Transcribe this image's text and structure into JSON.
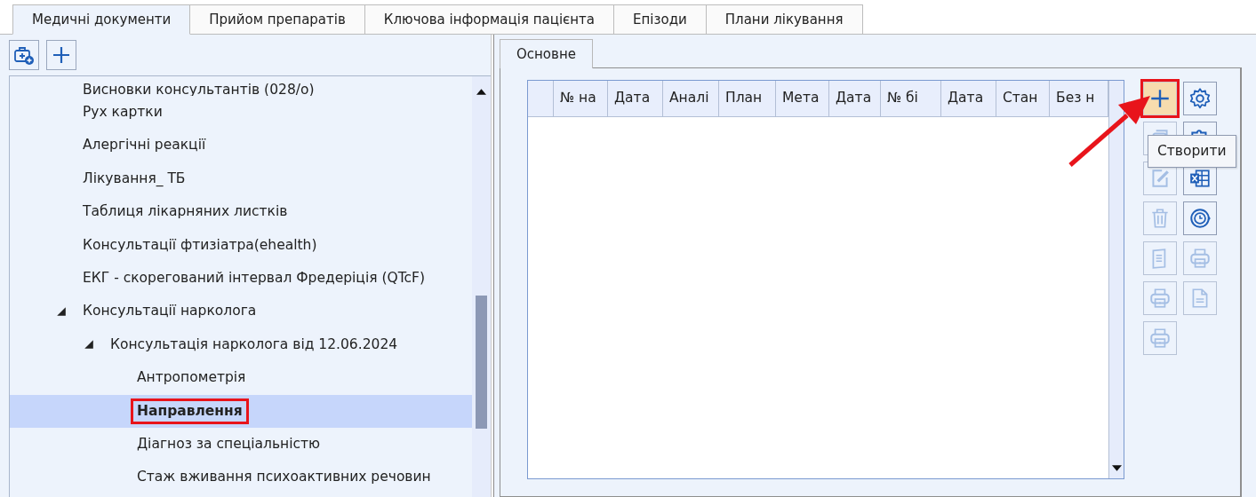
{
  "tabs": [
    {
      "label": "Медичні документи",
      "selected": true
    },
    {
      "label": "Прийом препаратів",
      "selected": false
    },
    {
      "label": "Ключова інформація пацієнта",
      "selected": false
    },
    {
      "label": "Епізоди",
      "selected": false
    },
    {
      "label": "Плани лікування",
      "selected": false
    }
  ],
  "left_toolbar": [
    {
      "kind": "add-kit"
    },
    {
      "kind": "plus"
    }
  ],
  "tree": {
    "items": [
      {
        "label": "Висновки консультантів (028/о)",
        "selected": false,
        "annotated": false
      },
      {
        "label": "Рух картки",
        "selected": false,
        "annotated": false
      },
      {
        "label": "Алергічні реакції",
        "selected": false,
        "annotated": false
      },
      {
        "label": "Лікування_ ТБ",
        "selected": false,
        "annotated": false
      },
      {
        "label": "Таблиця лікарняних листків",
        "selected": false,
        "annotated": false
      },
      {
        "label": "Консультації фтизіатра(ehealth)",
        "selected": false,
        "annotated": false
      },
      {
        "label": "ЕКГ - скорегований інтервал Фредеріція (QTcF)",
        "selected": false,
        "annotated": false
      },
      {
        "label": "Консультації нарколога",
        "selected": false,
        "annotated": false,
        "expanded": true,
        "children": [
          {
            "label": "Консультація нарколога від 12.06.2024",
            "selected": false,
            "annotated": false,
            "expanded": true,
            "children": [
              {
                "label": "Антропометрія",
                "selected": false,
                "annotated": false
              },
              {
                "label": "Направлення",
                "selected": true,
                "annotated": true
              },
              {
                "label": "Діагноз за спеціальністю",
                "selected": false,
                "annotated": false
              },
              {
                "label": "Стаж вживання психоактивних речовин",
                "selected": false,
                "annotated": false
              }
            ]
          }
        ]
      }
    ]
  },
  "inner_tabs": [
    {
      "label": "Основне",
      "selected": true
    }
  ],
  "table": {
    "columns": [
      "№ на",
      "Дата",
      "Аналі",
      "План",
      "Мета",
      "Дата",
      "№ бі",
      "Дата",
      "Стан",
      "Без н"
    ]
  },
  "tools": [
    {
      "kind": "plus",
      "enabled": true,
      "hovered": true,
      "annotated": true
    },
    {
      "kind": "gear",
      "enabled": true,
      "hovered": false,
      "annotated": false
    },
    {
      "kind": "copy",
      "enabled": false,
      "hovered": false,
      "annotated": false
    },
    {
      "kind": "puzzle",
      "enabled": true,
      "hovered": false,
      "annotated": false
    },
    {
      "kind": "edit",
      "enabled": false,
      "hovered": false,
      "annotated": false
    },
    {
      "kind": "excel",
      "enabled": true,
      "hovered": false,
      "annotated": false
    },
    {
      "kind": "trash",
      "enabled": false,
      "hovered": false,
      "annotated": false
    },
    {
      "kind": "clock",
      "enabled": true,
      "hovered": false,
      "annotated": false
    },
    {
      "kind": "document",
      "enabled": false,
      "hovered": false,
      "annotated": false
    },
    {
      "kind": "printer",
      "enabled": false,
      "hovered": false,
      "annotated": false
    },
    {
      "kind": "printer",
      "enabled": false,
      "hovered": false,
      "annotated": false
    },
    {
      "kind": "file",
      "enabled": false,
      "hovered": false,
      "annotated": false
    },
    {
      "kind": "printer",
      "enabled": false,
      "hovered": false,
      "annotated": false
    }
  ],
  "tooltip": {
    "text": "Створити"
  }
}
